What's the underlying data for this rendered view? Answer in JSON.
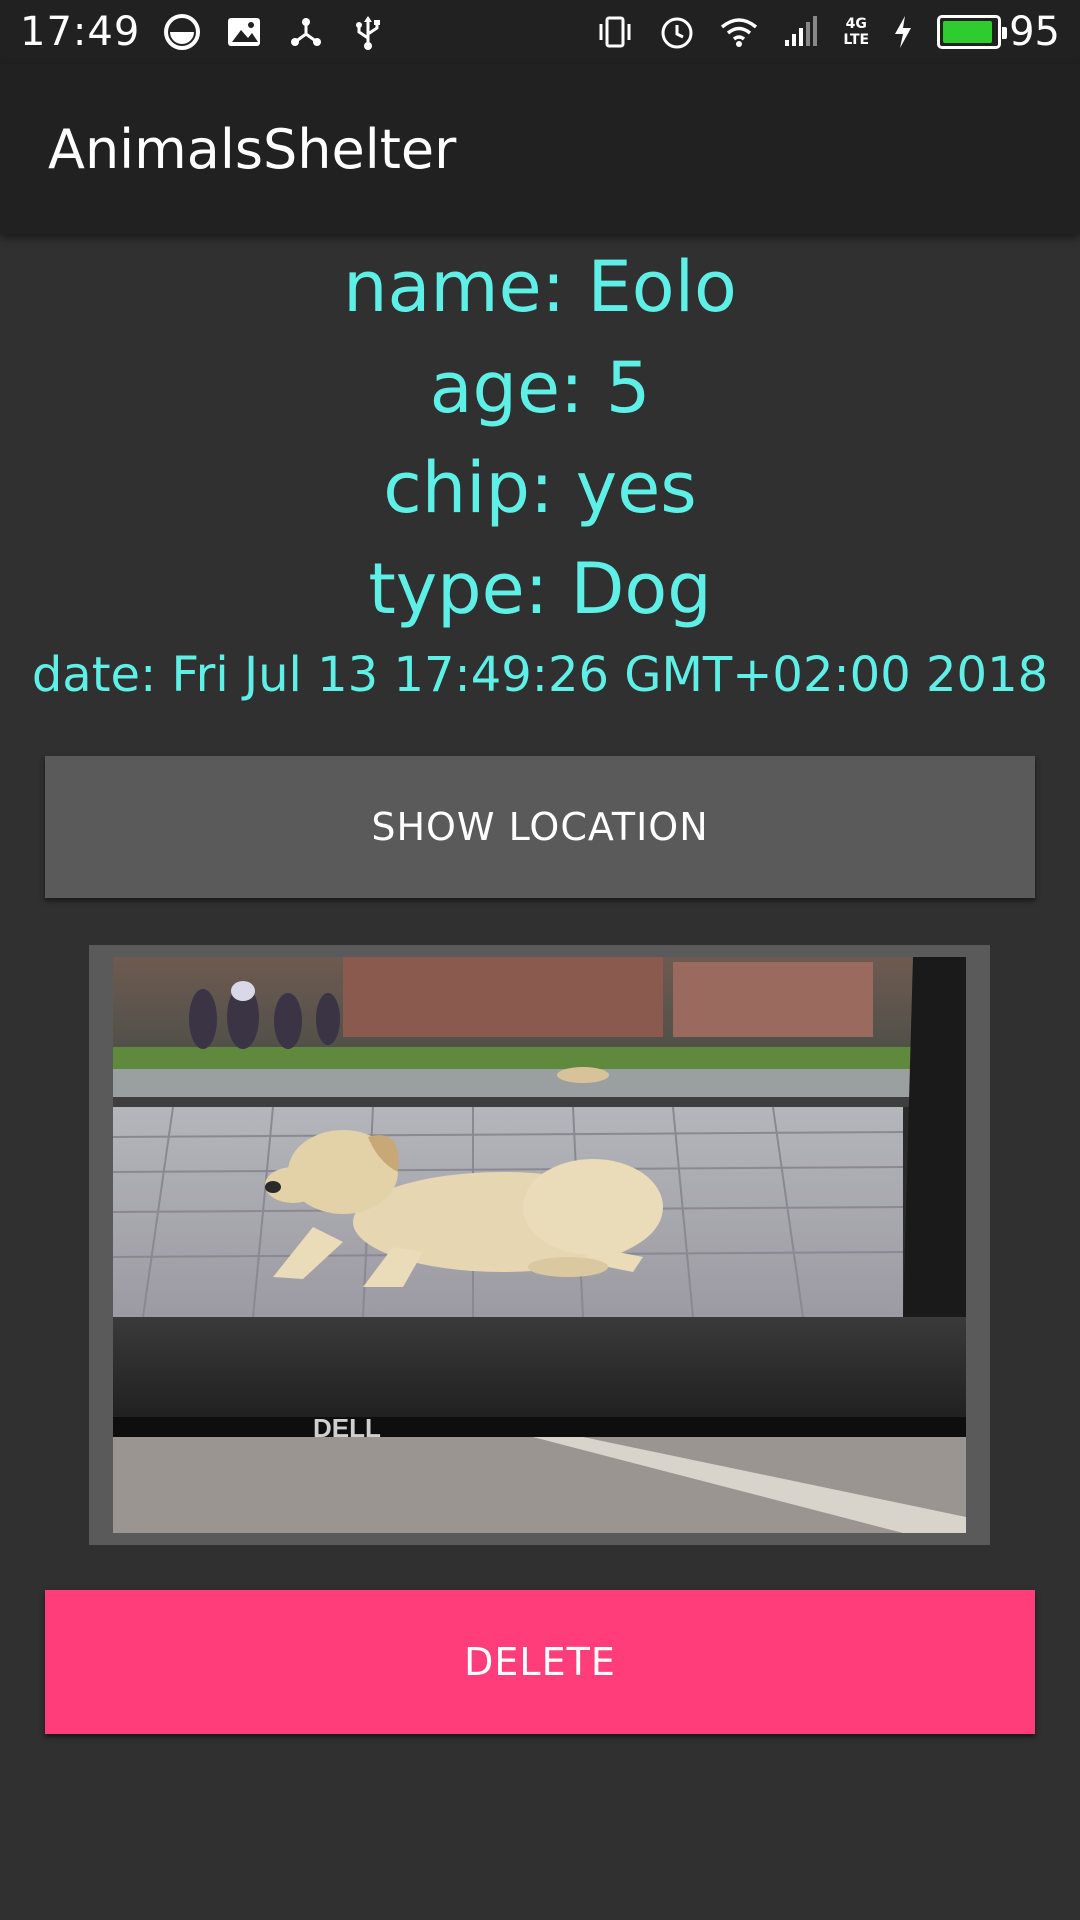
{
  "status_bar": {
    "time": "17:49",
    "network_label_top": "4G",
    "network_label_bottom": "LTE",
    "battery_percent": "95",
    "battery_level": 0.95,
    "icons": [
      "data-saver-icon",
      "image-icon",
      "share-icon",
      "usb-icon",
      "vibrate-icon",
      "alarm-icon",
      "wifi-icon",
      "signal-icon",
      "charging-icon",
      "battery-icon"
    ]
  },
  "app_bar": {
    "title": "AnimalsShelter"
  },
  "animal": {
    "name": "name: Eolo",
    "age": "age: 5",
    "chip": "chip: yes",
    "type": "type: Dog",
    "date": "date: Fri Jul 13 17:49:26 GMT+02:00 2018"
  },
  "buttons": {
    "show_location": "SHOW LOCATION",
    "delete": "DELETE"
  },
  "photo": {
    "logo_text": "DELL"
  },
  "colors": {
    "background": "#303030",
    "app_bar": "#212121",
    "info_text": "#5ef0e6",
    "secondary_button": "#5a5a5a",
    "accent_button": "#ff3d7a"
  }
}
